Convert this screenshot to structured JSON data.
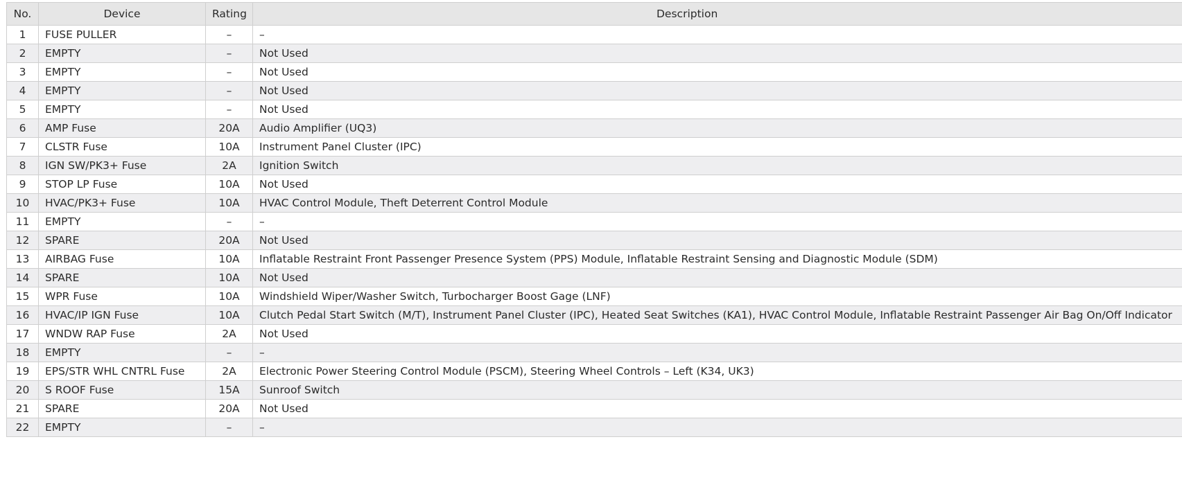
{
  "headers": {
    "no": "No.",
    "device": "Device",
    "rating": "Rating",
    "description": "Description"
  },
  "rows": [
    {
      "no": "1",
      "device": "FUSE PULLER",
      "rating": "–",
      "description": "–"
    },
    {
      "no": "2",
      "device": "EMPTY",
      "rating": "–",
      "description": "Not Used"
    },
    {
      "no": "3",
      "device": "EMPTY",
      "rating": "–",
      "description": "Not Used"
    },
    {
      "no": "4",
      "device": "EMPTY",
      "rating": "–",
      "description": "Not Used"
    },
    {
      "no": "5",
      "device": "EMPTY",
      "rating": "–",
      "description": "Not Used"
    },
    {
      "no": "6",
      "device": "AMP Fuse",
      "rating": "20A",
      "description": "Audio Amplifier (UQ3)"
    },
    {
      "no": "7",
      "device": "CLSTR Fuse",
      "rating": "10A",
      "description": "Instrument Panel Cluster (IPC)"
    },
    {
      "no": "8",
      "device": "IGN SW/PK3+ Fuse",
      "rating": "2A",
      "description": "Ignition Switch"
    },
    {
      "no": "9",
      "device": "STOP LP Fuse",
      "rating": "10A",
      "description": "Not Used"
    },
    {
      "no": "10",
      "device": "HVAC/PK3+ Fuse",
      "rating": "10A",
      "description": "HVAC Control Module, Theft Deterrent Control Module"
    },
    {
      "no": "11",
      "device": "EMPTY",
      "rating": "–",
      "description": "–"
    },
    {
      "no": "12",
      "device": "SPARE",
      "rating": "20A",
      "description": "Not Used"
    },
    {
      "no": "13",
      "device": "AIRBAG Fuse",
      "rating": "10A",
      "description": "Inflatable Restraint Front Passenger Presence System (PPS) Module, Inflatable Restraint Sensing and Diagnostic Module (SDM)"
    },
    {
      "no": "14",
      "device": "SPARE",
      "rating": "10A",
      "description": "Not Used"
    },
    {
      "no": "15",
      "device": "WPR Fuse",
      "rating": "10A",
      "description": "Windshield Wiper/Washer Switch, Turbocharger Boost Gage (LNF)"
    },
    {
      "no": "16",
      "device": "HVAC/IP IGN Fuse",
      "rating": "10A",
      "description": "Clutch Pedal Start Switch (M/T), Instrument Panel Cluster (IPC), Heated Seat Switches (KA1), HVAC Control Module, Inflatable Restraint Passenger Air Bag On/Off Indicator"
    },
    {
      "no": "17",
      "device": "WNDW RAP Fuse",
      "rating": "2A",
      "description": "Not Used"
    },
    {
      "no": "18",
      "device": "EMPTY",
      "rating": "–",
      "description": "–"
    },
    {
      "no": "19",
      "device": "EPS/STR WHL CNTRL Fuse",
      "rating": "2A",
      "description": "Electronic Power Steering Control Module (PSCM), Steering Wheel Controls – Left (K34, UK3)"
    },
    {
      "no": "20",
      "device": "S ROOF Fuse",
      "rating": "15A",
      "description": "Sunroof Switch"
    },
    {
      "no": "21",
      "device": "SPARE",
      "rating": "20A",
      "description": "Not Used"
    },
    {
      "no": "22",
      "device": "EMPTY",
      "rating": "–",
      "description": "–"
    }
  ]
}
